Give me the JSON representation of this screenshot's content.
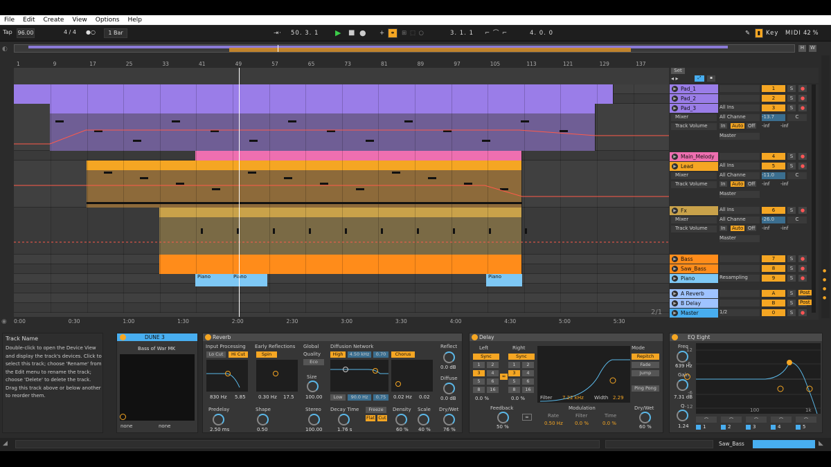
{
  "menu": [
    "File",
    "Edit",
    "Create",
    "View",
    "Options",
    "Help"
  ],
  "transport": {
    "tap": "Tap",
    "tempo": "96.00",
    "signature": "4 / 4",
    "quantize": "1 Bar",
    "position": "50.  3.  1",
    "loop_start": "3.  1.  1",
    "loop_length": "4.  0.  0",
    "key": "Key",
    "midi": "MIDI",
    "cpu": "42 %"
  },
  "ruler": [
    "1",
    "9",
    "17",
    "25",
    "33",
    "41",
    "49",
    "57",
    "65",
    "73",
    "81",
    "89",
    "97",
    "105",
    "113",
    "121",
    "129",
    "137"
  ],
  "timeline": [
    "0:00",
    "0:30",
    "1:00",
    "1:30",
    "2:00",
    "2:30",
    "3:00",
    "3:30",
    "4:00",
    "4:30",
    "5:00",
    "5:30"
  ],
  "set_label": "Set",
  "fraction": "2/1",
  "tracks": [
    {
      "name": "Pad_1",
      "num": "1",
      "color": "#9a7de8"
    },
    {
      "name": "Pad_2",
      "num": "2",
      "color": "#9a7de8"
    },
    {
      "name": "Pad_3",
      "num": "3",
      "color": "#9a7de8",
      "input": "All Ins",
      "channel": "All Channe",
      "vol": "-13.7",
      "pan": "C",
      "io": "Master",
      "mixer": "Mixer",
      "auto": "Track Volume"
    },
    {
      "name": "Main_Melody",
      "num": "4",
      "color": "#ee6fb0"
    },
    {
      "name": "Lead",
      "num": "5",
      "color": "#f5a623",
      "input": "All Ins",
      "channel": "All Channe",
      "vol": "-11.0",
      "pan": "C",
      "io": "Master",
      "mixer": "Mixer",
      "auto": "Track Volume"
    },
    {
      "name": "Fx",
      "num": "6",
      "color": "#c9a24a",
      "input": "All Ins",
      "channel": "All Channe",
      "vol": "-26.0",
      "pan": "C",
      "io": "Master",
      "mixer": "Mixer",
      "auto": "Track Volume"
    },
    {
      "name": "Bass",
      "num": "7",
      "color": "#ff8c1a"
    },
    {
      "name": "Saw_Bass",
      "num": "8",
      "color": "#ff8c1a"
    },
    {
      "name": "Piano",
      "num": "9",
      "color": "#7ec8f5",
      "io": "Resampling"
    },
    {
      "name": "A Reverb",
      "num": "A",
      "color": "#9fc3ff"
    },
    {
      "name": "B Delay",
      "num": "B",
      "color": "#9fc3ff"
    },
    {
      "name": "Master",
      "num": "0",
      "color": "#48aef0",
      "io": "1/2"
    }
  ],
  "io_labels": {
    "in": "In",
    "auto": "Auto",
    "off": "Off",
    "inf": "-inf",
    "post": "Post",
    "s": "S"
  },
  "piano_clips": [
    "Piano",
    "Piano",
    "Piano"
  ],
  "info": {
    "title": "Track Name",
    "text": "Double-click to open the Device View and display the track's devices. Click to select this track; choose 'Rename' from the Edit menu to rename the track; choose 'Delete' to delete the track. Drag this track above or below another to reorder them."
  },
  "dune": {
    "title": "DUNE 3",
    "preset": "Bass of War MK",
    "left": "none",
    "right": "none"
  },
  "reverb": {
    "title": "Reverb",
    "input": "Input Processing",
    "locut": "Lo Cut",
    "hicut": "Hi Cut",
    "early": "Early Reflections",
    "spin": "Spin",
    "global": "Global",
    "quality": "Quality",
    "eco": "Eco",
    "diffusion": "Diffusion Network",
    "high": "High",
    "hz1": "4.50 kHz",
    "v1": "0.70",
    "chorus": "Chorus",
    "f1": "830 Hz",
    "f2": "5.85",
    "f3": "0.30 Hz",
    "f4": "17.5",
    "size": "Size",
    "size_v": "100.00",
    "low": "Low",
    "lowhz": "90.0 Hz",
    "low_v": "0.75",
    "chf": "0.02 Hz",
    "chv": "0.02",
    "reflect": "Reflect",
    "reflect_v": "0.0 dB",
    "diffuse": "Diffuse",
    "diffuse_v": "0.0 dB",
    "predelay": "Predelay",
    "predelay_v": "2.50 ms",
    "shape": "Shape",
    "shape_v": "0.50",
    "stereo": "Stereo",
    "stereo_v": "100.00",
    "decay": "Decay Time",
    "decay_v": "1.76 s",
    "freeze": "Freeze",
    "flat": "Flat",
    "cut": "Cut",
    "density": "Density",
    "density_v": "60 %",
    "scale": "Scale",
    "scale_v": "40 %",
    "drywet": "Dry/Wet",
    "drywet_v": "76 %"
  },
  "delay": {
    "title": "Delay",
    "left": "Left",
    "right": "Right",
    "sync": "Sync",
    "grid": [
      "1",
      "2",
      "3",
      "4",
      "5",
      "6",
      "8",
      "16"
    ],
    "l_off": "0.0 %",
    "r_off": "0.0 %",
    "feedback": "Feedback",
    "feedback_v": "50 %",
    "filter": "Filter",
    "filter_v": "7.22 kHz",
    "width": "Width",
    "width_v": "2.29",
    "modulation": "Modulation",
    "rate": "Rate",
    "rate_v": "0.50 Hz",
    "filt": "Filter",
    "filt_v": "0.0 %",
    "time": "Time",
    "time_v": "0.0 %",
    "mode": "Mode",
    "repitch": "Repitch",
    "fade": "Fade",
    "jump": "Jump",
    "pingpong": "Ping Pong",
    "drywet": "Dry/Wet",
    "drywet_v": "60 %"
  },
  "eq": {
    "title": "EQ Eight",
    "freq": "Freq",
    "freq_v": "639 Hz",
    "gain": "Gain",
    "gain_v": "7.31 dB",
    "q": "Q",
    "q_v": "1.24",
    "db": [
      "12",
      "6",
      "0",
      "-6",
      "-12"
    ],
    "hz": [
      "100",
      "1k"
    ],
    "bands": [
      "1",
      "2",
      "3",
      "4",
      "5"
    ]
  },
  "status": {
    "track": "Saw_Bass"
  }
}
